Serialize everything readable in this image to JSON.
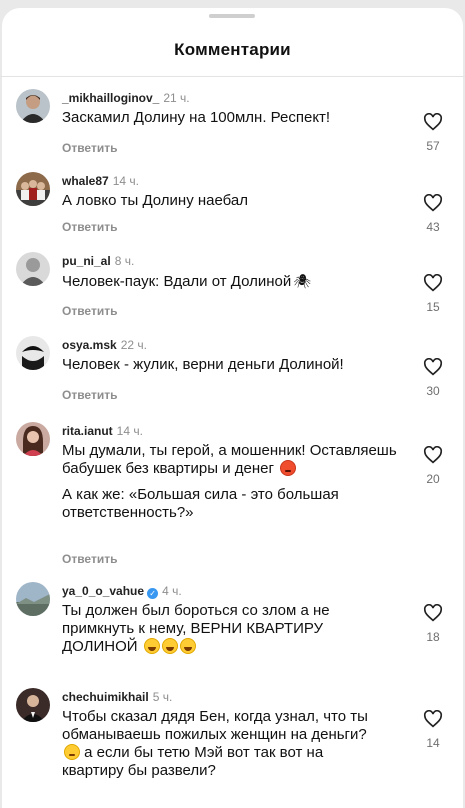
{
  "header": {
    "title": "Комментарии"
  },
  "colors": {
    "accent": "#3897f0",
    "muted": "#8e8e8e"
  },
  "comments": [
    {
      "username": "_mikhailloginov_",
      "time": "21 ч.",
      "text": [
        "Заскамил Долину на 100млн. Респект!"
      ],
      "reply": "Ответить",
      "likes": "57",
      "avatar_icon": "man-avatar"
    },
    {
      "username": "whale87",
      "time": "14 ч.",
      "text": [
        "А ловко ты Долину наебал"
      ],
      "reply": "Ответить",
      "likes": "43",
      "avatar_icon": "group-avatar"
    },
    {
      "username": "pu_ni_al",
      "time": "8 ч.",
      "text": [
        "Человек-паук: Вдали от Долиной"
      ],
      "reply": "Ответить",
      "likes": "15",
      "avatar_icon": "portrait-avatar",
      "emoji": "spider"
    },
    {
      "username": "osya.msk",
      "time": "22 ч.",
      "text": [
        "Человек - жулик, верни деньги Долиной!"
      ],
      "reply": "Ответить",
      "likes": "30",
      "avatar_icon": "monochrome-avatar"
    },
    {
      "username": "rita.ianut",
      "time": "14 ч.",
      "text": [
        "Мы думали, ты герой, а мошенник! Оставляешь бабушек без квартиры и денег",
        "А как же: «Большая сила - это большая ответственность?»"
      ],
      "reply": "Ответить",
      "likes": "20",
      "avatar_icon": "woman-avatar",
      "emoji": "angry-face"
    },
    {
      "username": "ya_0_o_vahue",
      "time": "4 ч.",
      "verified": true,
      "text": [
        "Ты должен был бороться со злом а не примкнуть к нему, ВЕРНИ КВАРТИРУ ДОЛИНОЙ"
      ],
      "reply": "",
      "likes": "18",
      "avatar_icon": "landscape-avatar",
      "emoji": "laughing-faces"
    },
    {
      "username": "chechuimikhail",
      "time": "5 ч.",
      "text": [
        "Чтобы сказал дядя Бен, когда узнал, что ты обманываешь пожилых женщин на деньги?",
        "а если бы тетю Мэй вот так вот на квартиру бы развели?"
      ],
      "reply": "",
      "likes": "14",
      "avatar_icon": "suit-avatar",
      "emoji": "sad-face"
    }
  ]
}
